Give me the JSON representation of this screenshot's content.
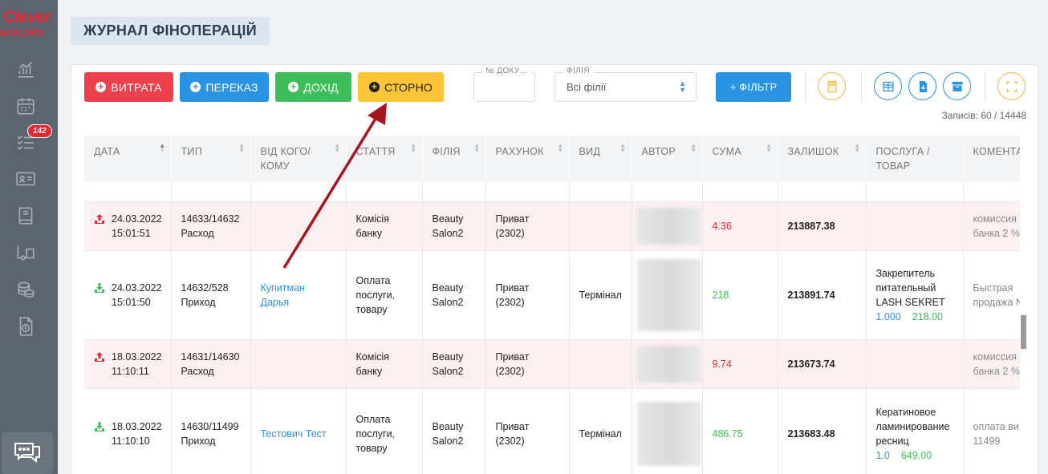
{
  "brand": {
    "line1": "Clever",
    "line2": "BOX.CRM",
    "color": "#e8262e"
  },
  "sidebar": {
    "items": [
      {
        "name": "analytics-icon"
      },
      {
        "name": "calendar-icon"
      },
      {
        "name": "tasks-icon"
      },
      {
        "name": "contacts-card-icon"
      },
      {
        "name": "book-icon"
      },
      {
        "name": "warehouse-icon"
      },
      {
        "name": "coins-icon"
      },
      {
        "name": "finance-document-icon"
      }
    ],
    "badge": "142",
    "chat_icon": "chat-icon"
  },
  "header": {
    "title": "ЖУРНАЛ ФІНОПЕРАЦІЙ"
  },
  "toolbar": {
    "expense_label": "ВИТРАТА",
    "transfer_label": "ПЕРЕКАЗ",
    "income_label": "ДОХІД",
    "storno_label": "СТОРНО",
    "doc_label": "№ ДОКУ…",
    "doc_value": "",
    "branch_label": "ФІЛІЯ",
    "branch_value": "Всі філії",
    "filter_label": "+ ФІЛЬТР",
    "icons": [
      "calculator-icon",
      "columns-icon",
      "download-icon",
      "archive-icon",
      "fullscreen-icon"
    ],
    "colors": {
      "red": "#ee3f4d",
      "blue": "#2b93e4",
      "green": "#3ebe5a",
      "yellow": "#fcc437"
    }
  },
  "records_text": "Записів: 60 / 14448",
  "table": {
    "headers": [
      "ДАТА",
      "ТИП",
      "ВІД КОГО/КОМУ",
      "СТАТТЯ",
      "ФІЛІЯ",
      "РАХУНОК",
      "ВИД",
      "АВТОР",
      "СУМА",
      "ЗАЛИШОК",
      "ПОСЛУГА / ТОВАР",
      "КОМЕНТАР"
    ],
    "rows": [
      {
        "kind": "expense",
        "date": "24.03.2022",
        "time": "15:01:51",
        "type_num": "14633/14632",
        "type_name": "Расход",
        "party": "",
        "article": [
          "Комісія",
          "банку"
        ],
        "branch": [
          "Beauty",
          "Salon2"
        ],
        "account": [
          "Приват",
          "(2302)"
        ],
        "view": "",
        "sum": "4.36",
        "balance": "213887.38",
        "service": [],
        "qty": "",
        "price": "",
        "comment": [
          "комиссия",
          "банка 2 %"
        ]
      },
      {
        "kind": "income",
        "date": "24.03.2022",
        "time": "15:01:50",
        "type_num": "14632/528",
        "type_name": "Приход",
        "party": [
          "Купитман",
          "Дарья"
        ],
        "article": [
          "Оплата",
          "послуги,",
          "товару"
        ],
        "branch": [
          "Beauty",
          "Salon2"
        ],
        "account": [
          "Приват",
          "(2302)"
        ],
        "view": "Термінал",
        "sum": "218",
        "balance": "213891.74",
        "service": [
          "Закрепитель",
          "питательный",
          "LASH SEKRET"
        ],
        "qty": "1.000",
        "price": "218.00",
        "comment": [
          "Быстрая",
          "продажа №"
        ]
      },
      {
        "kind": "expense",
        "date": "18.03.2022",
        "time": "11:10:11",
        "type_num": "14631/14630",
        "type_name": "Расход",
        "party": "",
        "article": [
          "Комісія",
          "банку"
        ],
        "branch": [
          "Beauty",
          "Salon2"
        ],
        "account": [
          "Приват",
          "(2302)"
        ],
        "view": "",
        "sum": "9.74",
        "balance": "213673.74",
        "service": [],
        "qty": "",
        "price": "",
        "comment": [
          "комиссия",
          "банка 2 %"
        ]
      },
      {
        "kind": "income",
        "date": "18.03.2022",
        "time": "11:10:10",
        "type_num": "14630/11499",
        "type_name": "Приход",
        "party": [
          "Тестович Тест"
        ],
        "article": [
          "Оплата",
          "послуги,",
          "товару"
        ],
        "branch": [
          "Beauty",
          "Salon2"
        ],
        "account": [
          "Приват",
          "(2302)"
        ],
        "view": "Термінал",
        "sum": "486.75",
        "balance": "213683.48",
        "service": [
          "Кератиновое",
          "ламинирование",
          "ресниц"
        ],
        "qty": "1.0",
        "price": "649.00",
        "comment": [
          "оплата ви",
          "11499"
        ]
      }
    ]
  }
}
